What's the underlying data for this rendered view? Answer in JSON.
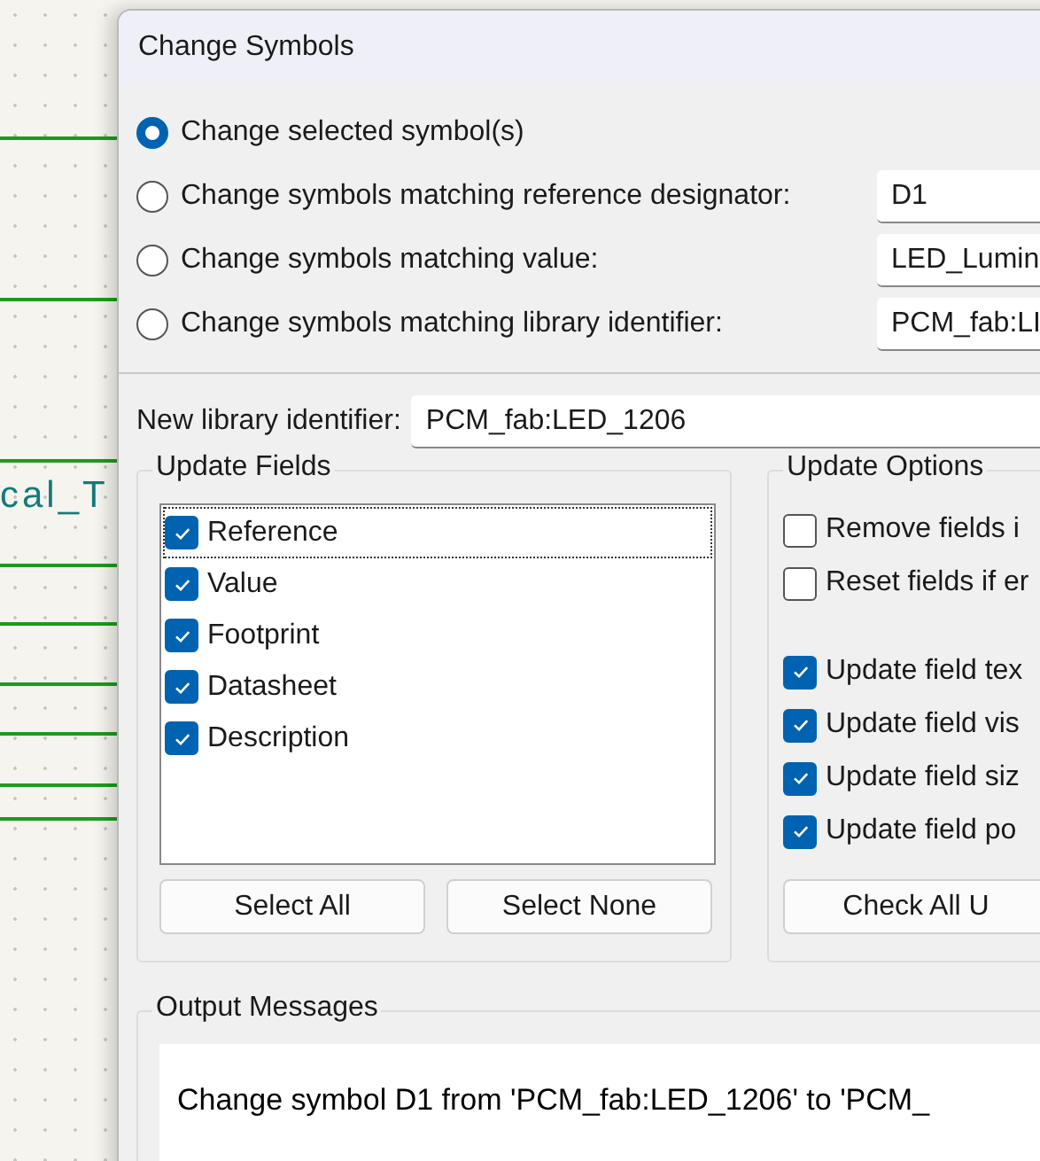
{
  "background": {
    "label": "cal_T"
  },
  "dialog": {
    "title": "Change Symbols"
  },
  "scope_options": [
    {
      "label": "Change selected symbol(s)",
      "selected": true
    },
    {
      "label": "Change symbols matching reference designator:",
      "selected": false,
      "value": "D1"
    },
    {
      "label": "Change symbols matching value:",
      "selected": false,
      "value": "LED_Lumin"
    },
    {
      "label": "Change symbols matching library identifier:",
      "selected": false,
      "value": "PCM_fab:LI"
    }
  ],
  "new_library_identifier": {
    "label": "New library identifier:",
    "value": "PCM_fab:LED_1206"
  },
  "update_fields": {
    "title": "Update Fields",
    "items": [
      {
        "label": "Reference",
        "checked": true,
        "focused": true
      },
      {
        "label": "Value",
        "checked": true,
        "focused": false
      },
      {
        "label": "Footprint",
        "checked": true,
        "focused": false
      },
      {
        "label": "Datasheet",
        "checked": true,
        "focused": false
      },
      {
        "label": "Description",
        "checked": true,
        "focused": false
      }
    ],
    "buttons": [
      "Select All",
      "Select None"
    ]
  },
  "update_options": {
    "title": "Update Options",
    "items": [
      {
        "label": "Remove fields i",
        "checked": false,
        "gap_before": false
      },
      {
        "label": "Reset fields if er",
        "checked": false,
        "gap_before": false
      },
      {
        "label": "Update field tex",
        "checked": true,
        "gap_before": true
      },
      {
        "label": "Update field vis",
        "checked": true,
        "gap_before": false
      },
      {
        "label": "Update field siz",
        "checked": true,
        "gap_before": false
      },
      {
        "label": "Update field po",
        "checked": true,
        "gap_before": false
      }
    ],
    "button": "Check All U"
  },
  "output_messages": {
    "title": "Output Messages",
    "lines": [
      "Change symbol D1 from 'PCM_fab:LED_1206' to 'PCM_"
    ]
  }
}
